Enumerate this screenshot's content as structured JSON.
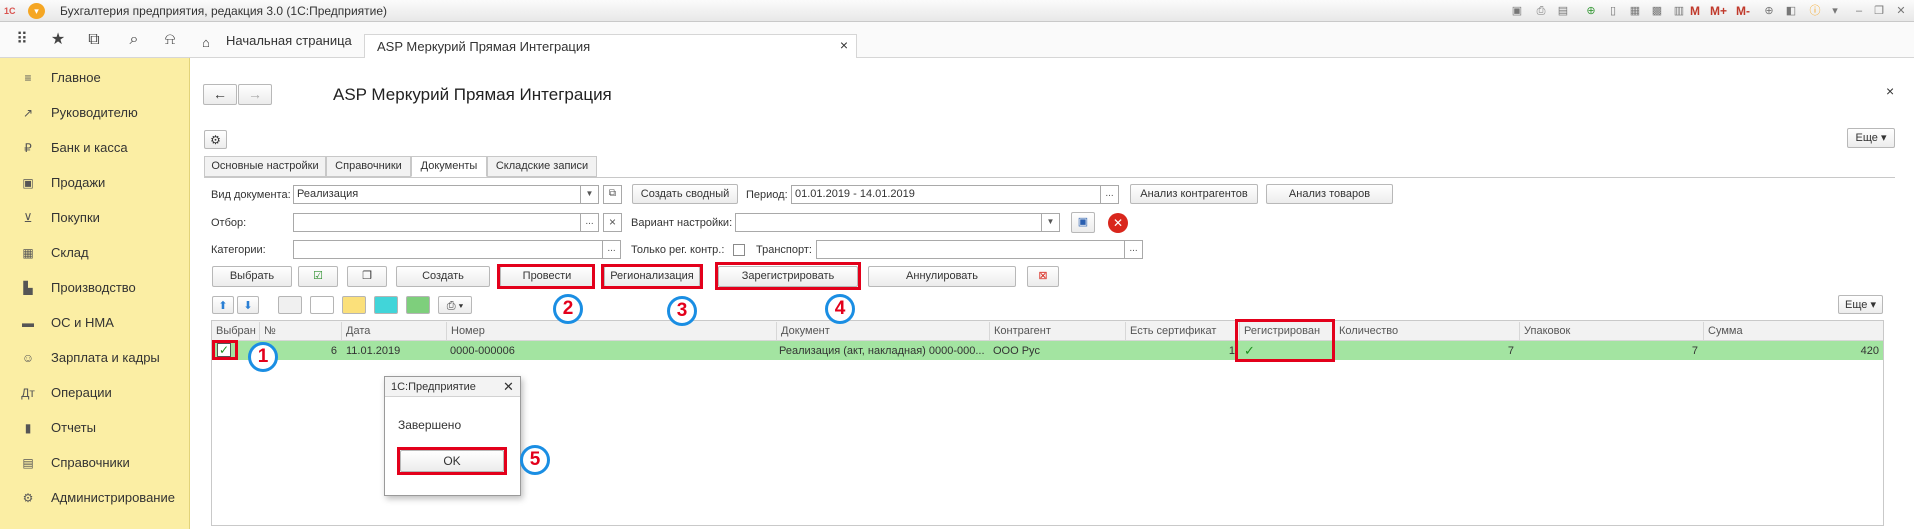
{
  "window": {
    "title": "Бухгалтерия предприятия, редакция 3.0  (1С:Предприятие)",
    "logo": "1С",
    "toolbar_m": "M",
    "toolbar_mplus": "M+",
    "toolbar_mminus": "M-"
  },
  "nav": {
    "home_tab": "Начальная страница",
    "doc_tab": "ASP Меркурий Прямая Интеграция",
    "close": "×"
  },
  "sidebar": {
    "items": [
      {
        "icon": "≡",
        "label": "Главное"
      },
      {
        "icon": "↗",
        "label": "Руководителю"
      },
      {
        "icon": "₽",
        "label": "Банк и касса"
      },
      {
        "icon": "▣",
        "label": "Продажи"
      },
      {
        "icon": "⊻",
        "label": "Покупки"
      },
      {
        "icon": "▦",
        "label": "Склад"
      },
      {
        "icon": "▙",
        "label": "Производство"
      },
      {
        "icon": "▬",
        "label": "ОС и НМА"
      },
      {
        "icon": "☺",
        "label": "Зарплата и кадры"
      },
      {
        "icon": "Дт",
        "label": "Операции"
      },
      {
        "icon": "▮",
        "label": "Отчеты"
      },
      {
        "icon": "▤",
        "label": "Справочники"
      },
      {
        "icon": "⚙",
        "label": "Администрирование"
      }
    ]
  },
  "form": {
    "back": "←",
    "forward": "→",
    "title": "ASP Меркурий Прямая Интеграция",
    "close": "×",
    "settings_icon": "⚙",
    "more": "Еще ▾",
    "more2": "Еще ▾",
    "tabs": [
      "Основные настройки",
      "Справочники",
      "Документы",
      "Складские записи"
    ],
    "doc_type_label": "Вид документа:",
    "doc_type_value": "Реализация",
    "create_summary": "Создать сводный",
    "period_label": "Период:",
    "period_value": "01.01.2019 - 14.01.2019",
    "ellipsis": "...",
    "analysis_contractors": "Анализ контрагентов",
    "analysis_goods": "Анализ товаров",
    "filter_label": "Отбор:",
    "filter_value": "",
    "clear": "×",
    "variant_label": "Вариант настройки:",
    "variant_value": "",
    "categories_label": "Категории:",
    "categories_value": "",
    "only_reg_label": "Только рег. контр.:",
    "transport_label": "Транспорт:",
    "transport_value": "",
    "buttons": {
      "select": "Выбрать",
      "create": "Создать",
      "post": "Провести",
      "regionalize": "Регионализация",
      "register": "Зарегистрировать",
      "annul": "Аннулировать"
    },
    "arrow_up": "⬆",
    "arrow_down": "⬇",
    "print": "⎙ ▾"
  },
  "table": {
    "headers": [
      "Выбран",
      "№",
      "Дата",
      "Номер",
      "Документ",
      "Контрагент",
      "Есть сертификат",
      "Регистрирован",
      "Количество",
      "Упаковок",
      "Сумма"
    ],
    "row": {
      "selected": "✓",
      "num": "6",
      "date": "11.01.2019",
      "number": "0000-000006",
      "document": "Реализация (акт, накладная) 0000-000...",
      "contractor": "ООО Рус",
      "cert": "1",
      "registered": "✓",
      "qty": "7",
      "packs": "7",
      "sum": "420"
    }
  },
  "dialog": {
    "title": "1С:Предприятие",
    "close": "✕",
    "message": "Завершено",
    "ok": "OK"
  },
  "markers": [
    "1",
    "2",
    "3",
    "4",
    "5"
  ],
  "colors": {
    "sidebar": "#fbeea4",
    "row_selected": "#a3e4a1",
    "highlight": "#e3001b",
    "marker_ring": "#1a8ee3"
  }
}
